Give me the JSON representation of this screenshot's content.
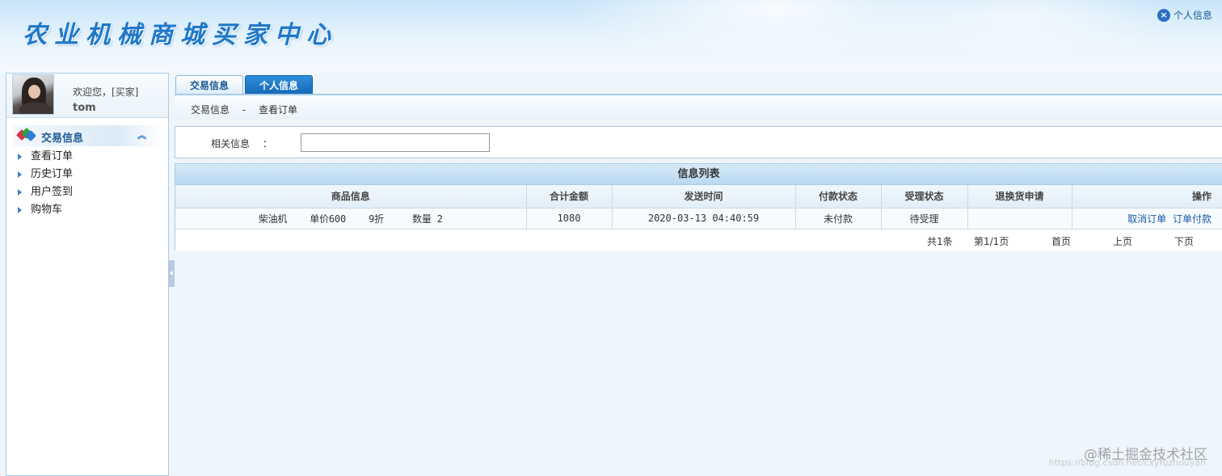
{
  "header": {
    "title": "农业机械商城买家中心",
    "top_link": "个人信息"
  },
  "sidebar": {
    "welcome": "欢迎您，[买家]",
    "username": "tom",
    "menu_title": "交易信息",
    "items": [
      {
        "label": "查看订单"
      },
      {
        "label": "历史订单"
      },
      {
        "label": "用户签到"
      },
      {
        "label": "购物车"
      }
    ]
  },
  "tabs": [
    {
      "label": "交易信息",
      "active": true
    },
    {
      "label": "个人信息",
      "active": false
    }
  ],
  "breadcrumb": {
    "section": "交易信息",
    "separator": "-",
    "page": "查看订单"
  },
  "search": {
    "label": "相关信息",
    "colon": "：",
    "value": ""
  },
  "table": {
    "title": "信息列表",
    "columns": [
      "商品信息",
      "合计金额",
      "发送时间",
      "付款状态",
      "受理状态",
      "退换货申请",
      "操作"
    ],
    "rows": [
      {
        "product": "柴油机    单价600    9折     数量 2",
        "total": "1080",
        "time": "2020-03-13 04:40:59",
        "pay_status": "未付款",
        "accept_status": "待受理",
        "return_request": "",
        "actions": [
          "取消订单",
          "订单付款"
        ]
      }
    ],
    "pager": {
      "total": "共1条",
      "page": "第1/1页",
      "first": "首页",
      "prev": "上页",
      "next": "下页"
    }
  },
  "watermark": {
    "main": "@稀土掘金技术社区",
    "sub": "https://blog.csdn.net/cxyfuzhouyan"
  },
  "colors": {
    "accent": "#1a5a94",
    "title_blue": "#1f78c8",
    "tab_active_bg": "#dcebf7",
    "tab_inactive_bg": "#1568b6"
  }
}
